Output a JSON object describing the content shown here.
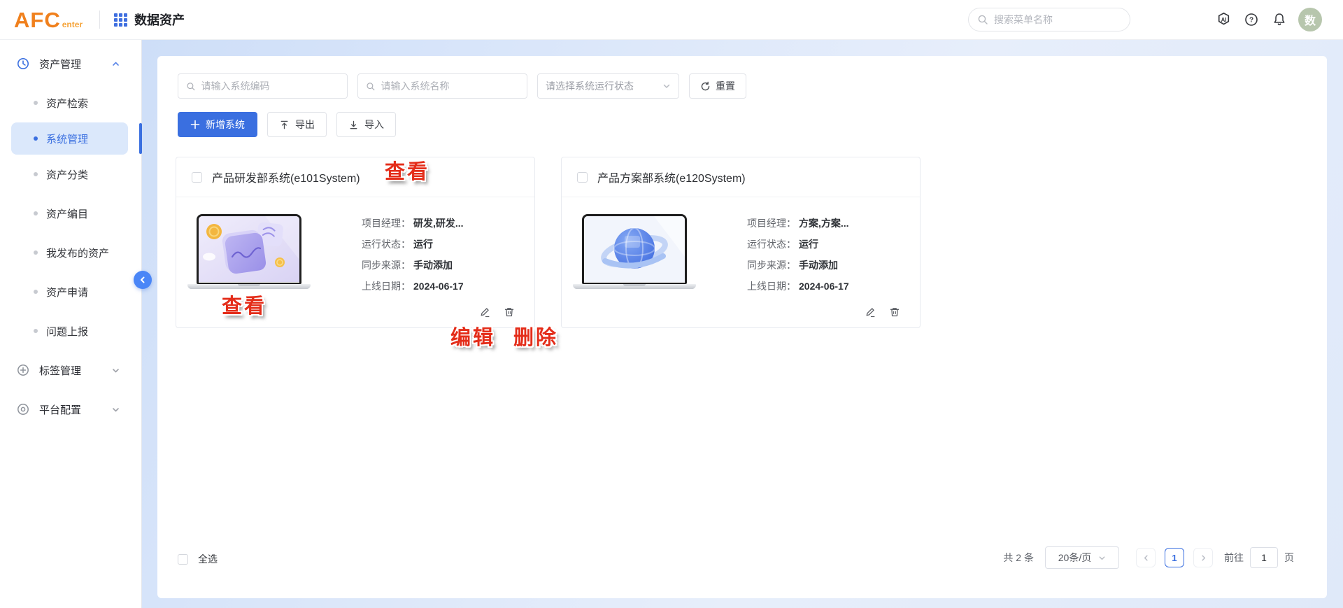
{
  "colors": {
    "primary": "#3a6fe0",
    "annotation_red": "#e42d1a",
    "avatar_bg": "#b7c6ad",
    "logo_orange": "#f0801d",
    "selected_menu_bg": "#dbe8fb"
  },
  "header": {
    "logo_main": "AFC",
    "logo_sub": "enter",
    "app_title": "数据资产",
    "search_placeholder": "搜索菜单名称",
    "avatar_text": "数"
  },
  "sidebar": {
    "group_asset": {
      "label": "资产管理"
    },
    "items": [
      "资产检索",
      "系统管理",
      "资产分类",
      "资产编目",
      "我发布的资产",
      "资产申请",
      "问题上报"
    ],
    "active_item": "系统管理",
    "group_tag": {
      "label": "标签管理"
    },
    "group_platform": {
      "label": "平台配置"
    }
  },
  "filters": {
    "code_placeholder": "请输入系统编码",
    "name_placeholder": "请输入系统名称",
    "status_placeholder": "请选择系统运行状态",
    "reset_label": "重置"
  },
  "toolbar": {
    "add_label": "新增系统",
    "export_label": "导出",
    "import_label": "导入"
  },
  "cards": [
    {
      "title": "产品研发部系统(e101System)",
      "image": "laptop-purple-cube-coins",
      "fields": [
        {
          "label": "项目经理：",
          "value": "研发,研发..."
        },
        {
          "label": "运行状态：",
          "value": "运行"
        },
        {
          "label": "同步来源：",
          "value": "手动添加"
        },
        {
          "label": "上线日期：",
          "value": "2024-06-17"
        }
      ]
    },
    {
      "title": "产品方案部系统(e120System)",
      "image": "laptop-blue-globe",
      "fields": [
        {
          "label": "项目经理：",
          "value": "方案,方案..."
        },
        {
          "label": "运行状态：",
          "value": "运行"
        },
        {
          "label": "同步来源：",
          "value": "手动添加"
        },
        {
          "label": "上线日期：",
          "value": "2024-06-17"
        }
      ]
    }
  ],
  "annotations": {
    "view_title": "查看",
    "view_image": "查看",
    "edit": "编辑",
    "delete": "删除"
  },
  "footer": {
    "select_all_label": "全选",
    "total_text": "共 2 条",
    "page_size_value": "20条/页",
    "current_page": "1",
    "goto_label": "前往",
    "goto_value": "1",
    "page_unit": "页"
  }
}
